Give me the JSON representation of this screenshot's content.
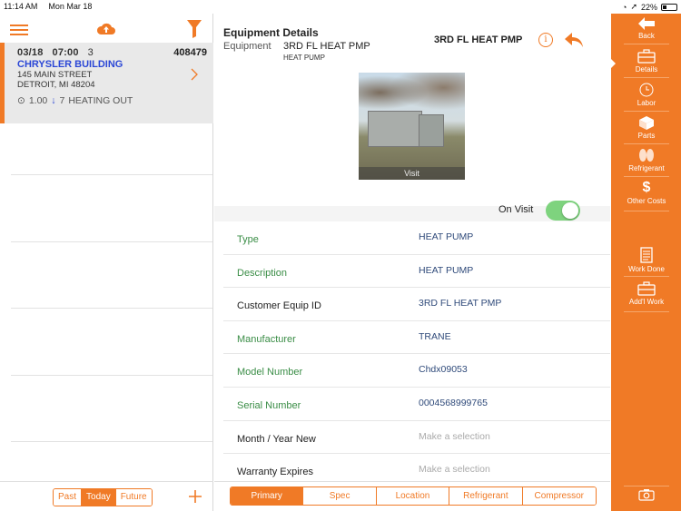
{
  "status_bar": {
    "time": "11:14 AM",
    "date": "Mon Mar 18",
    "battery": "22%"
  },
  "left_panel": {
    "work_order": {
      "date": "03/18",
      "time": "07:00",
      "count": "3",
      "number": "408479",
      "building": "CHRYSLER BUILDING",
      "street": "145 MAIN STREET",
      "city": "DETROIT, MI 48204",
      "hours": "1.00",
      "priority": "7",
      "problem": "HEATING OUT"
    },
    "filter_tabs": [
      "Past",
      "Today",
      "Future"
    ],
    "selected_filter": "Today"
  },
  "equipment": {
    "section_title": "Equipment Details",
    "equipment_label": "Equipment",
    "equipment_name": "3RD FL HEAT PMP",
    "equipment_type": "HEAT PUMP",
    "header_name": "3RD FL HEAT PMP",
    "photo_caption": "Visit",
    "on_visit_label": "On Visit",
    "on_visit": true,
    "fields": [
      {
        "label": "Type",
        "value": "HEAT PUMP",
        "required": true,
        "placeholder": false
      },
      {
        "label": "Description",
        "value": "HEAT PUMP",
        "required": true,
        "placeholder": false
      },
      {
        "label": "Customer Equip ID",
        "value": "3RD FL HEAT PMP",
        "required": false,
        "placeholder": false
      },
      {
        "label": "Manufacturer",
        "value": "TRANE",
        "required": true,
        "placeholder": false
      },
      {
        "label": "Model Number",
        "value": "Chdx09053",
        "required": true,
        "placeholder": false
      },
      {
        "label": "Serial Number",
        "value": "0004568999765",
        "required": true,
        "placeholder": false
      },
      {
        "label": "Month / Year New",
        "value": "Make a selection",
        "required": false,
        "placeholder": true
      },
      {
        "label": "Warranty Expires",
        "value": "Make a selection",
        "required": false,
        "placeholder": true
      }
    ],
    "tabs": [
      "Primary",
      "Spec",
      "Location",
      "Refrigerant",
      "Compressor"
    ],
    "selected_tab": "Primary"
  },
  "sidebar": {
    "items": [
      {
        "label": "Back",
        "icon": "back-arrow-icon"
      },
      {
        "label": "Details",
        "icon": "toolbox-icon"
      },
      {
        "label": "Labor",
        "icon": "clock-icon"
      },
      {
        "label": "Parts",
        "icon": "box-icon"
      },
      {
        "label": "Refrigerant",
        "icon": "refrigerant-icon"
      },
      {
        "label": "Other Costs",
        "icon": "dollar-icon"
      },
      {
        "label": "Work Done",
        "icon": "document-icon"
      },
      {
        "label": "Add'l Work",
        "icon": "toolbox-plus-icon"
      }
    ],
    "active": "Details",
    "camera_icon": "camera-icon"
  },
  "colors": {
    "accent": "#f07a26",
    "link": "#2b47d6",
    "field_label_green": "#3a8d46",
    "toggle_on": "#7ed37e"
  }
}
